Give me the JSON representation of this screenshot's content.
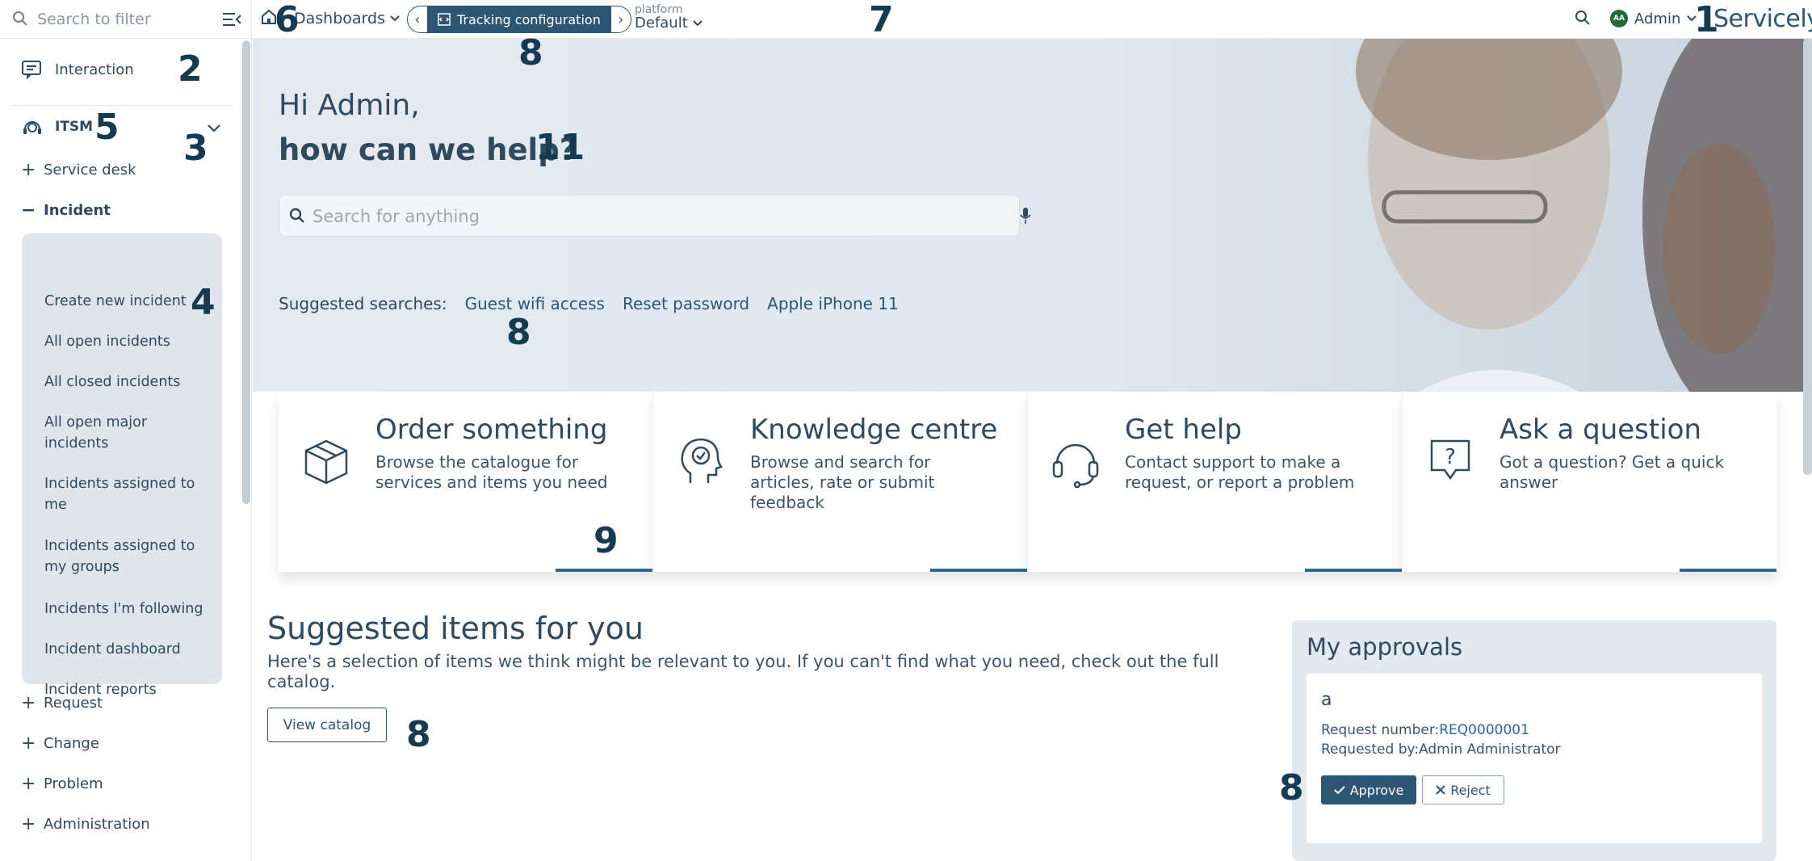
{
  "topbar": {
    "filter_placeholder": "Search to filter",
    "dashboards_label": "Dashboards",
    "active_tab_label": "Tracking configuration",
    "platform_label": "platform",
    "platform_value": "Default",
    "user_initials": "AA",
    "user_name": "Admin",
    "logo_text": "Servicely"
  },
  "sidebar": {
    "interaction_label": "Interaction",
    "itsm_label": "ITSM",
    "service_desk_label": "Service desk",
    "incident_label": "Incident",
    "incident_items": [
      "Create new incident",
      "All open incidents",
      "All closed incidents",
      "All open major incidents",
      "Incidents assigned to me",
      "Incidents assigned to my groups",
      "Incidents I'm following",
      "Incident dashboard",
      "Incident reports"
    ],
    "request_label": "Request",
    "change_label": "Change",
    "problem_label": "Problem",
    "administration_label": "Administration"
  },
  "hero": {
    "greeting": "Hi Admin,",
    "subtitle": "how can we help?",
    "search_placeholder": "Search for anything",
    "suggested_label": "Suggested searches:",
    "suggestions": [
      "Guest wifi access",
      "Reset password",
      "Apple iPhone 11"
    ]
  },
  "cards": [
    {
      "title": "Order something",
      "desc": "Browse the catalogue for services and items you need",
      "icon": "box-icon"
    },
    {
      "title": "Knowledge centre",
      "desc": "Browse and search for articles, rate or submit feedback",
      "icon": "head-idea-icon"
    },
    {
      "title": "Get help",
      "desc": "Contact support to make a request, or report a problem",
      "icon": "headset-icon"
    },
    {
      "title": "Ask a question",
      "desc": "Got a question? Get a quick answer",
      "icon": "question-bubble-icon"
    }
  ],
  "suggested_items": {
    "title": "Suggested items for you",
    "description": "Here's a selection of items we think might be relevant to you. If you can't find what you need, check out the full catalog.",
    "view_catalog_label": "View catalog"
  },
  "approvals": {
    "title": "My approvals",
    "item_title": "a",
    "request_number_label": "Request number:",
    "request_number": "REQ0000001",
    "requested_by_label": "Requested by:",
    "requested_by": "Admin Administrator",
    "approve_label": "Approve",
    "reject_label": "Reject"
  },
  "markers": {
    "m1": "1",
    "m2": "2",
    "m3": "3",
    "m4": "4",
    "m5": "5",
    "m6": "6",
    "m7": "7",
    "m8a": "8",
    "m8b": "8",
    "m8c": "8",
    "m8d": "8",
    "m9": "9",
    "m11": "11"
  },
  "colors": {
    "brand": "#2c5674",
    "text": "#2f4a5e",
    "hero_bg": "#e4eaf0",
    "submenu_bg": "#e0e5ec",
    "accent_bar": "#2c6a96"
  }
}
